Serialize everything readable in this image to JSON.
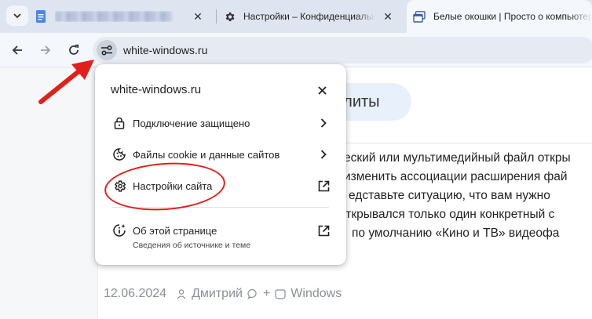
{
  "tabs": [
    {
      "title": "",
      "favicon": "docs-icon",
      "blurred": true,
      "active": false
    },
    {
      "title": "Настройки – Конфиденциальность и безопасность",
      "favicon": "gear-icon",
      "active": false
    },
    {
      "title": "Белые окошки | Просто о компьютерах",
      "favicon": "window-icon",
      "active": true
    }
  ],
  "toolbar": {
    "url": "white-windows.ru"
  },
  "page": {
    "pill_text": "илиты",
    "article_lines": [
      "еский или мультимедийный файл откры",
      "изменить ассоциации расширения фай",
      "едставьте ситуацию, что вам нужно",
      "открывался только один конкретный с",
      "по умолчанию «Кино и ТВ» видеофа"
    ],
    "meta": {
      "date": "12.06.2024",
      "author": "Дмитрий",
      "comments": "+",
      "category": "Windows"
    }
  },
  "popup": {
    "title": "white-windows.ru",
    "items": [
      {
        "label": "Подключение защищено",
        "icon": "lock-icon",
        "trail": "chevron-right-icon"
      },
      {
        "label": "Файлы cookie и данные сайтов",
        "icon": "cookie-icon",
        "trail": "chevron-right-icon"
      },
      {
        "label": "Настройки сайта",
        "icon": "gear-icon",
        "trail": "open-external-icon"
      }
    ],
    "about": {
      "label": "Об этой странице",
      "sublabel": "Сведения об источнике и теме",
      "icon": "info-sparkle-icon",
      "trail": "open-external-icon"
    }
  },
  "colors": {
    "annotation": "#e0201c",
    "tabstrip": "#dfe5f0",
    "toolbar": "#f4f7fc"
  }
}
